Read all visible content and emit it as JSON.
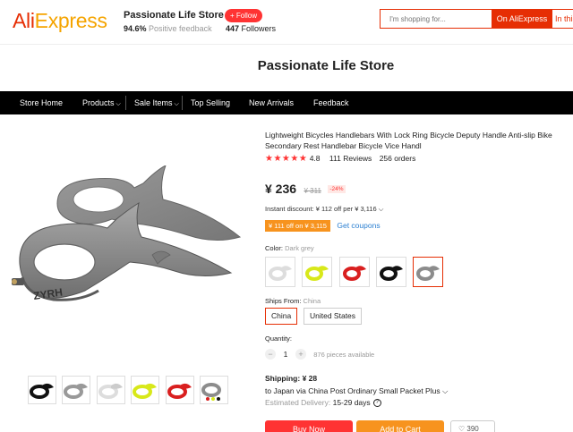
{
  "header": {
    "logo_part1": "Ali",
    "logo_part2": "Express",
    "store_name": "Passionate Life Store",
    "feedback_pct": "94.6%",
    "feedback_label": "Positive feedback",
    "follow_label": "+ Follow",
    "followers_count": "447",
    "followers_label": "Followers",
    "search_placeholder": "I'm shopping for...",
    "search_btn": "On AliExpress",
    "search_btn2": "In this"
  },
  "store_title": "Passionate Life Store",
  "nav": {
    "items": [
      "Store Home",
      "Products",
      "Sale Items",
      "Top Selling",
      "New Arrivals",
      "Feedback"
    ]
  },
  "product": {
    "title": "Lightweight Bicycles Handlebars With Lock Ring Bicycle Deputy Handle Anti-slip Bike Secondary Rest Handlebar Bicycle Vice Handl",
    "stars": "★★★★★",
    "rating": "4.8",
    "reviews": "111 Reviews",
    "orders": "256 orders",
    "price": "¥ 236",
    "old_price": "¥ 311",
    "discount": "-24%",
    "instant_discount": "Instant discount: ¥ 112 off per ¥ 3,116",
    "coupon": "¥ 111 off on ¥ 3,115",
    "get_coupons": "Get coupons",
    "color_label": "Color:",
    "color_value": "Dark grey",
    "color_swatches": [
      "#111111",
      "#d8e81a",
      "#d91f1f",
      "#111111",
      "#8c8c8c"
    ],
    "ships_from_label": "Ships From:",
    "ships_from_value": "China",
    "ship_options": [
      "China",
      "United States"
    ],
    "quantity_label": "Quantity:",
    "quantity_value": "1",
    "qty_minus": "−",
    "qty_plus": "+",
    "available": "876 pieces available",
    "shipping_label": "Shipping:",
    "shipping_price": "¥ 28",
    "ship_to": "to Japan via China Post Ordinary Small Packet Plus",
    "delivery_label": "Estimated Delivery:",
    "delivery_days": "15-29 days",
    "buy_now": "Buy Now",
    "add_to_cart": "Add to Cart",
    "wish_count": "390",
    "brand_text": "ZYRH",
    "thumb_colors": [
      "#111111",
      "#999999",
      "#dddddd",
      "#d8e81a",
      "#d91f1f",
      "#8c8c8c"
    ]
  },
  "colors": {
    "brand_red": "#e62e04",
    "orange": "#f7931e",
    "link_blue": "#2a7fd1"
  }
}
